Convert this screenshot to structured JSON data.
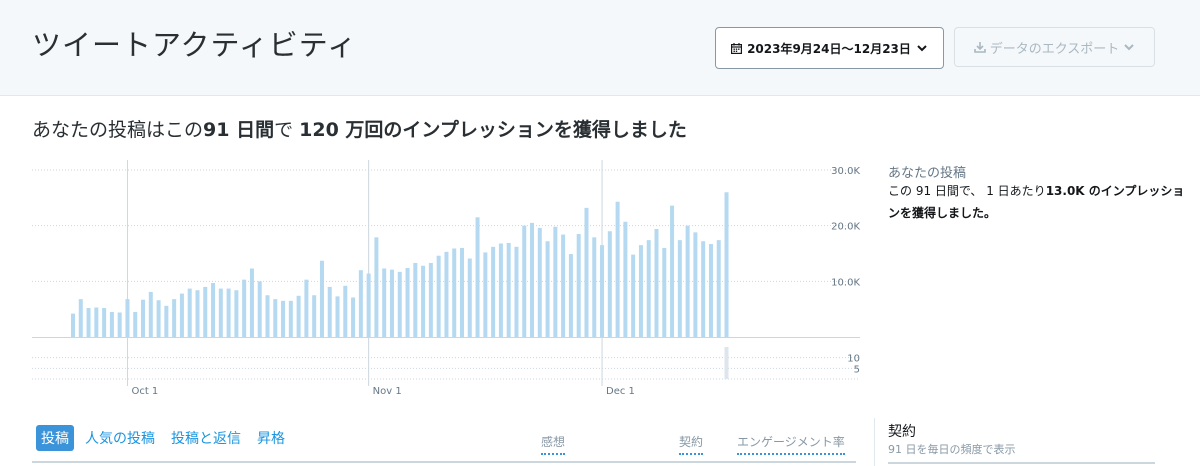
{
  "header": {
    "title": "ツイートアクティビティ",
    "date_range": "2023年9月24日～12月23日",
    "export_label": "データのエクスポート"
  },
  "headline": {
    "prefix": "あなたの投稿はこの",
    "days": "91 日間",
    "mid": "で ",
    "impressions": "120 万回のインプレッションを獲得しました"
  },
  "side": {
    "title": "あなたの投稿",
    "text_prefix": "この 91 日間で、 1 日あたり",
    "daily_avg": "13.0K",
    "text_suffix": " のインプレッションを獲得しました。"
  },
  "tabs": [
    "投稿",
    "人気の投稿",
    "投稿と返信",
    "昇格"
  ],
  "columns": [
    "感想",
    "契約",
    "エンゲージメント率"
  ],
  "right_panel": {
    "title": "契約",
    "subtitle": "91 日を毎日の頻度で表示"
  },
  "icons": {
    "calendar": "calendar-icon",
    "chevron": "chevron-down-icon",
    "download": "download-icon"
  },
  "colors": {
    "bar": "#b5d9f0",
    "accent": "#1b95e0",
    "active_tab": "#3b94d9"
  },
  "chart_data": {
    "type": "bar",
    "title": "",
    "xlabel": "",
    "ylabel": "",
    "x_start": "2023-09-24",
    "x_end": "2023-12-23",
    "xtick_labels": [
      "Oct 1",
      "Nov 1",
      "Dec 1"
    ],
    "xtick_dates": [
      "2023-10-01",
      "2023-11-01",
      "2023-12-01"
    ],
    "yticks_main": [
      "30.0K",
      "20.0K",
      "10.0K"
    ],
    "ylim_main": [
      0,
      30000
    ],
    "yticks_lower": [
      "10",
      "5"
    ],
    "series": [
      {
        "values": [
          4200,
          6800,
          5200,
          5300,
          5200,
          4500,
          4400,
          6800,
          4500,
          6700,
          8100,
          6600,
          5600,
          6800,
          7800,
          8700,
          8400,
          9000,
          9700,
          8700,
          8700,
          8400,
          10300,
          12300,
          10000,
          7500,
          6800,
          6500,
          6500,
          7400,
          10300,
          7500,
          13700,
          9000,
          7300,
          9200,
          7100,
          12000,
          11400,
          17900,
          12300,
          12100,
          11700,
          12400,
          13300,
          12800,
          13300,
          14600,
          15300,
          15900,
          16000,
          14100,
          21500,
          15200,
          16200,
          16800,
          16900,
          16200,
          20000,
          20500,
          19600,
          17200,
          19800,
          18400,
          14900,
          18500,
          23200,
          17900,
          16500,
          19000,
          24300,
          20700,
          14800,
          16500,
          17400,
          19400,
          16000,
          23600,
          17400,
          20000,
          18800,
          17200,
          16700,
          17400,
          26000
        ]
      }
    ],
    "lower_series": [
      {
        "values": [
          0,
          0,
          0,
          0,
          0,
          0,
          0,
          0,
          0,
          0,
          0,
          0,
          0,
          0,
          0,
          0,
          0,
          0,
          0,
          0,
          0,
          0,
          0,
          0,
          0,
          0,
          0,
          0,
          0,
          0,
          0,
          0,
          0,
          0,
          0,
          0,
          0,
          0,
          0,
          0,
          0,
          0,
          0,
          0,
          0,
          0,
          0,
          0,
          0,
          0,
          0,
          0,
          0,
          0,
          0,
          0,
          0,
          0,
          0,
          0,
          0,
          0,
          0,
          0,
          0,
          0,
          0,
          0,
          0,
          0,
          0,
          0,
          0,
          0,
          0,
          0,
          0,
          0,
          0,
          0,
          0,
          0,
          0,
          0,
          15
        ]
      }
    ],
    "ylim_lower": [
      0,
      15
    ],
    "grid": true
  }
}
